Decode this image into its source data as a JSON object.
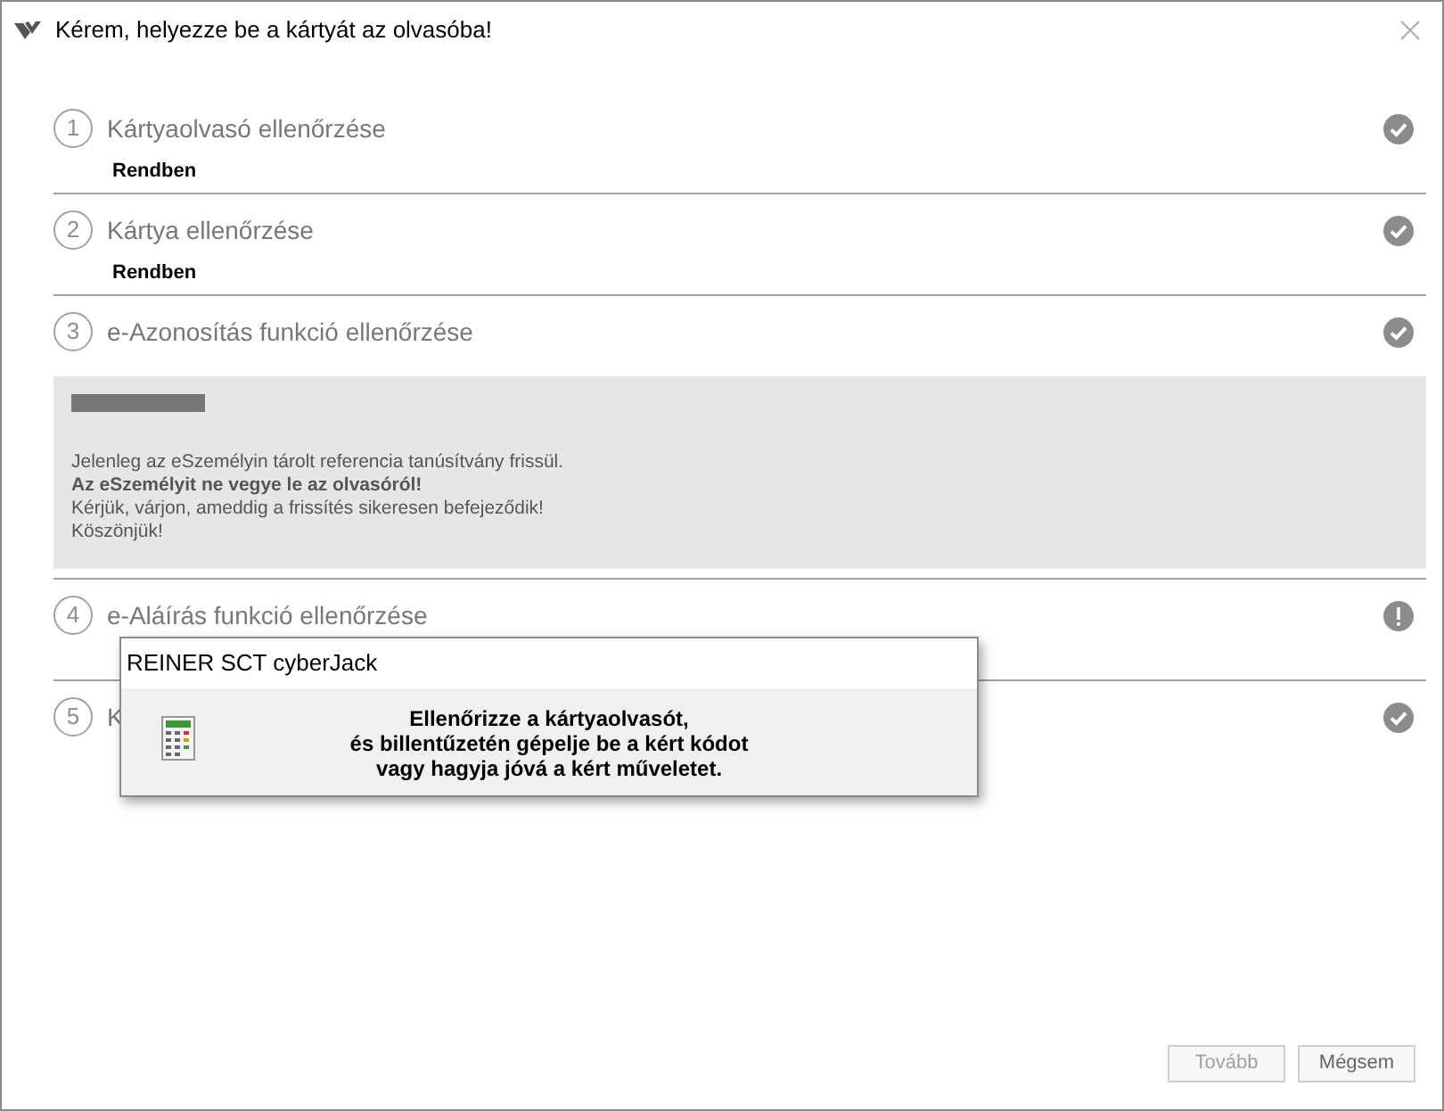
{
  "window": {
    "title": "Kérem, helyezze be a kártyát az olvasóba!"
  },
  "steps": [
    {
      "number": "1",
      "title": "Kártyaolvasó ellenőrzése",
      "kind": "ok",
      "result": "Rendben"
    },
    {
      "number": "2",
      "title": "Kártya ellenőrzése",
      "kind": "ok",
      "result": "Rendben"
    },
    {
      "number": "3",
      "title": "e-Azonosítás funkció ellenőrzése",
      "kind": "ok",
      "notice": [
        "Jelenleg az eSzemélyin tárolt referencia tanúsítvány frissül.",
        "**Az eSzemélyit ne vegye le az olvasóról!**",
        "Kérjük, várjon, ameddig a frissítés sikeresen befejeződik!",
        "Köszönjük!"
      ]
    },
    {
      "number": "4",
      "title": "e-Aláírás funkció ellenőrzése",
      "kind": "warning"
    },
    {
      "number": "5",
      "title": "K",
      "kind": "ok"
    }
  ],
  "popup": {
    "title": "REINER SCT cyberJack",
    "lines": [
      "Ellenőrizze a kártyaolvasót,",
      "és billentűzetén gépelje be a kért kódot",
      "vagy hagyja jóvá a kért műveletet."
    ]
  },
  "buttons": [
    {
      "label": "Tovább",
      "disabled": true
    },
    {
      "label": "Mégsem",
      "disabled": false
    }
  ]
}
